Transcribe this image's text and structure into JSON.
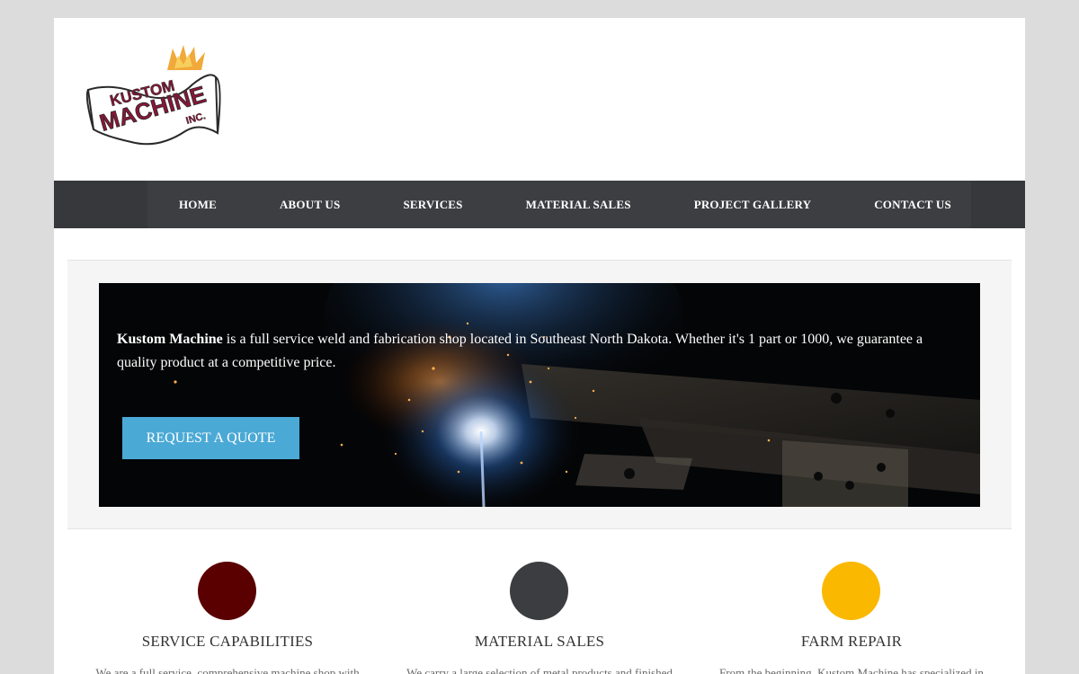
{
  "header": {
    "logo": {
      "line1": "KUSTOM",
      "line2": "MACHINE",
      "line3": "INC."
    }
  },
  "nav": {
    "items": [
      {
        "label": "HOME"
      },
      {
        "label": "ABOUT US"
      },
      {
        "label": "SERVICES"
      },
      {
        "label": "MATERIAL SALES"
      },
      {
        "label": "PROJECT GALLERY"
      },
      {
        "label": "CONTACT US"
      }
    ]
  },
  "hero": {
    "company": "Kustom Machine",
    "description": " is a full service weld and fabrication shop located in Southeast North Dakota. Whether it's 1 part or 1000, we guarantee a quality product at a competitive price.",
    "button_label": "REQUEST A QUOTE"
  },
  "features": [
    {
      "title": "SERVICE CAPABILITIES",
      "color": "#5a0000",
      "text": "We are a full service, comprehensive machine shop with"
    },
    {
      "title": "MATERIAL SALES",
      "color": "#3b3d40",
      "text": "We carry a large selection of metal products and finished"
    },
    {
      "title": "FARM REPAIR",
      "color": "#fbb800",
      "text": "From the beginning, Kustom Machine has specialized in"
    }
  ],
  "colors": {
    "nav_bg": "#36383b",
    "button": "#4ba9d6",
    "page_bg": "#dcdcdc"
  }
}
